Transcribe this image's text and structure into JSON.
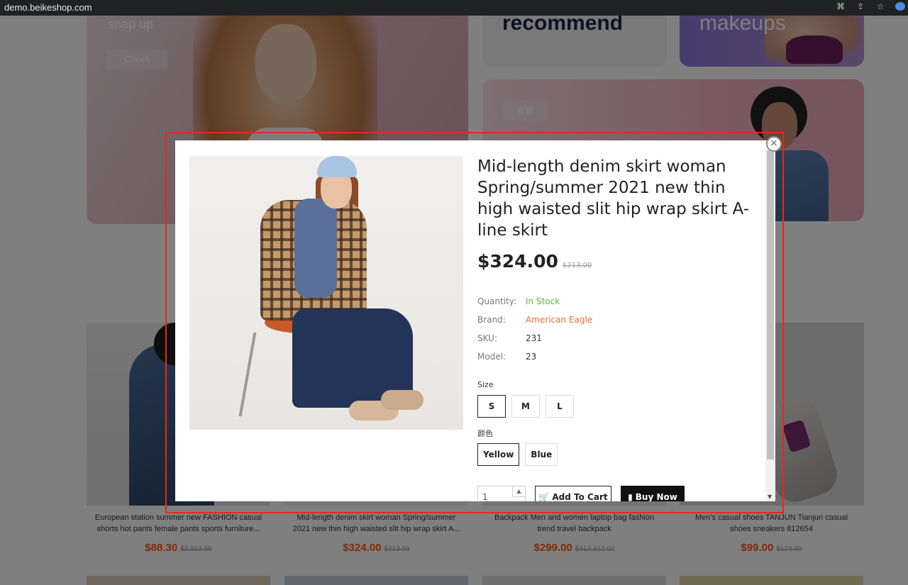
{
  "browser": {
    "url": "demo.beikeshop.com",
    "icons": [
      "translate-icon",
      "share-icon",
      "star-icon",
      "profile-icon"
    ]
  },
  "banners": {
    "left": {
      "title": "snap up",
      "button": "Check"
    },
    "recommend": {
      "title": "recommend"
    },
    "makeups": {
      "title": "makeups"
    },
    "pink": {
      "button": "查看"
    }
  },
  "products": [
    {
      "title_line1": "European station summer new FASHION casual",
      "title_line2": "shorts hot pants female pants sports furniture...",
      "price": "$88.30",
      "old_price": "$2,312.00"
    },
    {
      "title_line1": "Mid-length denim skirt woman Spring/summer",
      "title_line2": "2021 new thin high waisted slit hip wrap skirt A...",
      "price": "$324.00",
      "old_price": "$213.00"
    },
    {
      "title_line1": "Backpack Men and women laptop bag fashion",
      "title_line2": "trend travel backpack",
      "price": "$299.00",
      "old_price": "$312,312.00"
    },
    {
      "title_line1": "Men's casual shoes TANJUN Tianjun casual",
      "title_line2": "shoes sneakers 812654",
      "price": "$99.00",
      "old_price": "$123.00"
    }
  ],
  "modal": {
    "title": "Mid-length denim skirt woman Spring/summer 2021 new thin high waisted slit hip wrap skirt A-line skirt",
    "price": "$324.00",
    "old_price": "$213.00",
    "attributes": [
      {
        "key": "Quantity:",
        "value": "In Stock"
      },
      {
        "key": "Brand:",
        "value": "American Eagle"
      },
      {
        "key": "SKU:",
        "value": "231"
      },
      {
        "key": "Model:",
        "value": "23"
      }
    ],
    "size_label": "Size",
    "sizes": [
      "S",
      "M",
      "L"
    ],
    "selected_size": "S",
    "color_label": "颜色",
    "colors": [
      "Yellow",
      "Blue"
    ],
    "selected_color": "Yellow",
    "quantity": "1",
    "add_to_cart": "Add To Cart",
    "buy_now": "Buy Now",
    "close_symbol": "×"
  },
  "colors": {
    "price_accent": "#fd560f",
    "stock_green": "#5fb53b",
    "brand_orange": "#f06d2e",
    "highlight_red": "#e8271f"
  }
}
